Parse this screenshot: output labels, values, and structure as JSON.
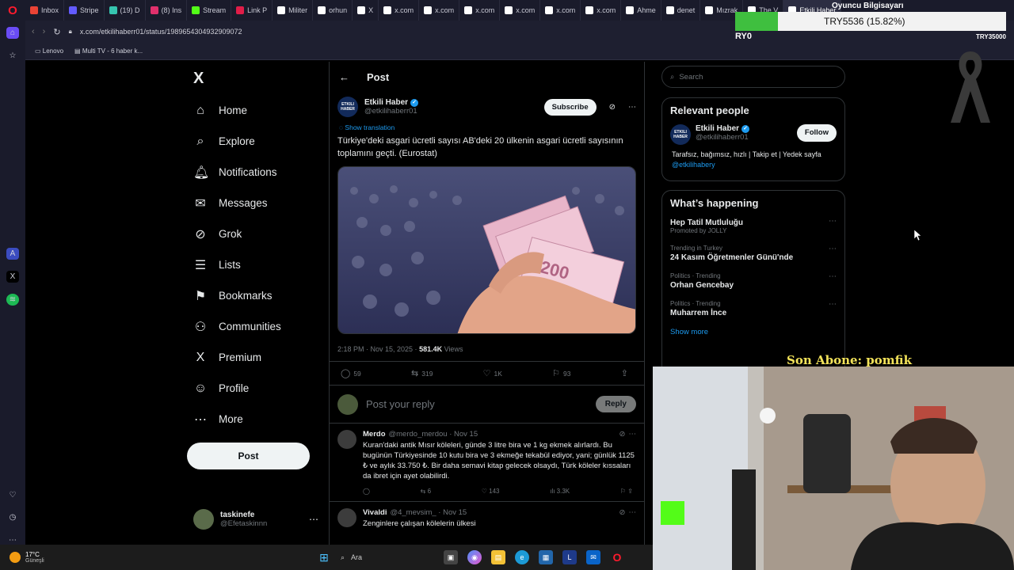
{
  "browser": {
    "tabs": [
      {
        "label": "Inbox",
        "color": "#ea4335"
      },
      {
        "label": "Stripe",
        "color": "#635bff"
      },
      {
        "label": "(19) D",
        "color": "#36c5b0"
      },
      {
        "label": "(8) Ins",
        "color": "#e1306c"
      },
      {
        "label": "Stream",
        "color": "#53fc18"
      },
      {
        "label": "Link P",
        "color": "#e11d48"
      },
      {
        "label": "Militer",
        "color": "#ffffff"
      },
      {
        "label": "orhun",
        "color": "#ffffff"
      },
      {
        "label": "X",
        "color": "#ffffff"
      },
      {
        "label": "x.com",
        "color": "#ffffff"
      },
      {
        "label": "x.com",
        "color": "#ffffff"
      },
      {
        "label": "x.com",
        "color": "#ffffff"
      },
      {
        "label": "x.com",
        "color": "#ffffff"
      },
      {
        "label": "x.com",
        "color": "#ffffff"
      },
      {
        "label": "x.com",
        "color": "#ffffff"
      },
      {
        "label": "Ahme",
        "color": "#ffffff"
      },
      {
        "label": "denet",
        "color": "#ffffff"
      },
      {
        "label": "Mızrak",
        "color": "#ffffff"
      },
      {
        "label": "The V",
        "color": "#ffffff"
      },
      {
        "label": "Etkili Haber",
        "color": "#ffffff",
        "active": true
      }
    ],
    "url": "x.com/etkilihaberr01/status/1989654304932909072",
    "bookmarks": [
      "Lenovo",
      "Multi TV - 6 haber k..."
    ]
  },
  "nav": {
    "logo": "X",
    "items": [
      {
        "label": "Home",
        "icon": "home-icon",
        "glyph": "⌂"
      },
      {
        "label": "Explore",
        "icon": "search-icon",
        "glyph": "⌕"
      },
      {
        "label": "Notifications",
        "icon": "bell-icon",
        "glyph": "🔔︎"
      },
      {
        "label": "Messages",
        "icon": "mail-icon",
        "glyph": "✉"
      },
      {
        "label": "Grok",
        "icon": "grok-icon",
        "glyph": "⊘"
      },
      {
        "label": "Lists",
        "icon": "list-icon",
        "glyph": "☰"
      },
      {
        "label": "Bookmarks",
        "icon": "bookmark-icon",
        "glyph": "⚑"
      },
      {
        "label": "Communities",
        "icon": "communities-icon",
        "glyph": "⚇"
      },
      {
        "label": "Premium",
        "icon": "x-icon",
        "glyph": "X"
      },
      {
        "label": "Profile",
        "icon": "profile-icon",
        "glyph": "☺"
      },
      {
        "label": "More",
        "icon": "more-icon",
        "glyph": "⋯"
      }
    ],
    "post_button": "Post",
    "account_name": "taskinefe",
    "account_handle": "@Efetaskinnn"
  },
  "post": {
    "header": "Post",
    "author_name": "Etkili Haber",
    "author_handle": "@etkilihaberr01",
    "avatar_text": "ETKILI HABER",
    "subscribe": "Subscribe",
    "translate": "Show translation",
    "text": "Türkiye'deki asgari ücretli sayısı AB'deki 20 ülkenin asgari ücretli sayısının toplamını geçti. (Eurostat)",
    "time": "2:18 PM · Nov 15, 2025 · ",
    "views": "581.4K",
    "views_label": " Views",
    "replies": "59",
    "reposts": "319",
    "likes": "1K",
    "bookmarks": "93"
  },
  "reply_box": {
    "placeholder": "Post your reply",
    "button": "Reply"
  },
  "replies": [
    {
      "name": "Merdo",
      "handle": "@merdo_merdou · Nov 15",
      "text": "Kuran'daki antik Mısır köleleri, günde 3 litre bira ve 1 kg ekmek alırlardı. Bu bugünün Türkiyesinde 10 kutu bira ve 3 ekmeğe tekabül ediyor, yani; günlük 1125 ₺ ve aylık 33.750 ₺. Bir daha semavi kitap gelecek olsaydı, Türk köleler kıssaları da ibret için ayet olabilirdi.",
      "replies": "",
      "reposts": "6",
      "likes": "143",
      "views": "3.3K"
    },
    {
      "name": "Vivaldi",
      "handle": "@4_mevsim_ · Nov 15",
      "text": "Zenginlere çalışan kölelerin ülkesi"
    }
  ],
  "right": {
    "search_placeholder": "Search",
    "relevant_title": "Relevant people",
    "rp_name": "Etkili Haber",
    "rp_handle": "@etkilihaberr01",
    "rp_follow": "Follow",
    "rp_bio": "Tarafsız, bağımsız, hızlı | Takip et | Yedek sayfa ",
    "rp_bio_link": "@etkilihabery",
    "happening_title": "What’s happening",
    "trends": [
      {
        "sub": "Promoted by JOLLY",
        "title": "Hep Tatil Mutluluğu",
        "promoted": true
      },
      {
        "sub": "Trending in Turkey",
        "title": "24 Kasım Öğretmenler Günü'nde"
      },
      {
        "sub": "Politics · Trending",
        "title": "Orhan Gencebay"
      },
      {
        "sub": "Politics · Trending",
        "title": "Muharrem İnce"
      }
    ],
    "show_more": "Show more"
  },
  "overlay": {
    "title": "Oyuncu Bilgisayarı",
    "value": "TRY5536 (15.82%)",
    "progress": 0.1582,
    "start": "RY0",
    "goal": "TRY35000",
    "subscriber": "Son Abone: pomfik"
  },
  "taskbar": {
    "temp": "17°C",
    "location": "Güneşli",
    "search": "Ara"
  }
}
